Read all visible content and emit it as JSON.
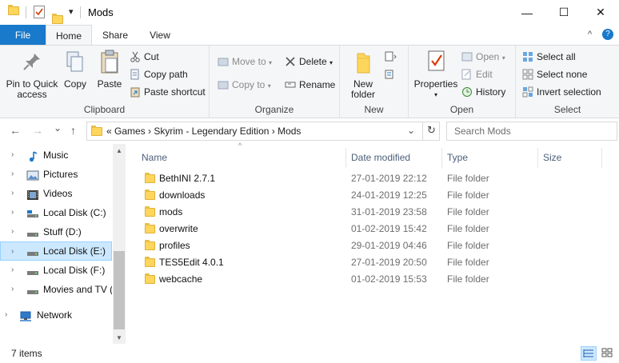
{
  "window": {
    "title": "Mods",
    "minimize_glyph": "—",
    "maximize_glyph": "☐",
    "close_glyph": "✕",
    "qa_dropdown_glyph": "▾"
  },
  "tabs": {
    "file": "File",
    "home": "Home",
    "share": "Share",
    "view": "View",
    "collapse_glyph": "^",
    "help_glyph": "?"
  },
  "ribbon": {
    "clipboard": {
      "label": "Clipboard",
      "pin": "Pin to Quick access",
      "copy": "Copy",
      "paste": "Paste",
      "cut": "Cut",
      "copy_path": "Copy path",
      "paste_shortcut": "Paste shortcut"
    },
    "organize": {
      "label": "Organize",
      "move_to": "Move to",
      "copy_to": "Copy to",
      "delete": "Delete",
      "rename": "Rename"
    },
    "new": {
      "label": "New",
      "new_folder": "New folder"
    },
    "open": {
      "label": "Open",
      "properties": "Properties",
      "open": "Open",
      "edit": "Edit",
      "history": "History"
    },
    "select": {
      "label": "Select",
      "select_all": "Select all",
      "select_none": "Select none",
      "invert_selection": "Invert selection"
    }
  },
  "address": {
    "back_glyph": "←",
    "forward_glyph": "→",
    "recent_glyph": "⌄",
    "up_glyph": "↑",
    "path": "«  Games  ›  Skyrim - Legendary Edition  ›  Mods",
    "dropdown_glyph": "⌄",
    "refresh_glyph": "↻",
    "search_placeholder": "Search Mods"
  },
  "nav": {
    "items": [
      {
        "label": "Music",
        "icon": "music-icon"
      },
      {
        "label": "Pictures",
        "icon": "pictures-icon"
      },
      {
        "label": "Videos",
        "icon": "videos-icon"
      },
      {
        "label": "Local Disk (C:)",
        "icon": "system-drive-icon"
      },
      {
        "label": "Stuff (D:)",
        "icon": "drive-icon"
      },
      {
        "label": "Local Disk (E:)",
        "icon": "drive-icon"
      },
      {
        "label": "Local Disk (F:)",
        "icon": "drive-icon"
      },
      {
        "label": "Movies and TV (",
        "icon": "drive-icon"
      },
      {
        "label": "Network",
        "icon": "network-icon"
      }
    ],
    "chevron": "›"
  },
  "columns": {
    "name": "Name",
    "date": "Date modified",
    "type": "Type",
    "size": "Size",
    "sort_glyph": "^"
  },
  "files": [
    {
      "name": "BethINI 2.7.1",
      "date": "27-01-2019 22:12",
      "type": "File folder"
    },
    {
      "name": "downloads",
      "date": "24-01-2019 12:25",
      "type": "File folder"
    },
    {
      "name": "mods",
      "date": "31-01-2019 23:58",
      "type": "File folder"
    },
    {
      "name": "overwrite",
      "date": "01-02-2019 15:42",
      "type": "File folder"
    },
    {
      "name": "profiles",
      "date": "29-01-2019 04:46",
      "type": "File folder"
    },
    {
      "name": "TES5Edit 4.0.1",
      "date": "27-01-2019 20:50",
      "type": "File folder"
    },
    {
      "name": "webcache",
      "date": "01-02-2019 15:53",
      "type": "File folder"
    }
  ],
  "status": {
    "count": "7 items"
  },
  "colors": {
    "accent": "#1979ca",
    "folder": "#ffd65c",
    "selection": "#cce8ff"
  }
}
